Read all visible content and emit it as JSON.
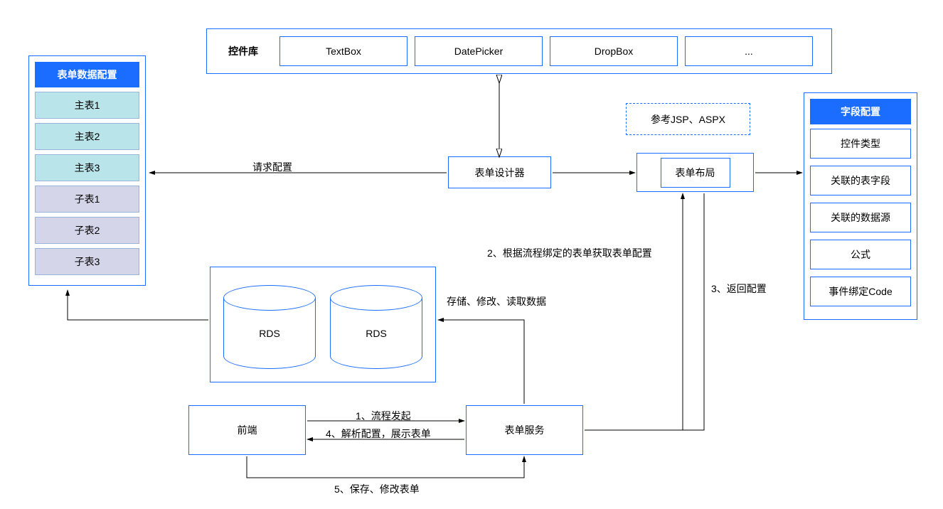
{
  "toolbar": {
    "label": "控件库",
    "items": [
      "TextBox",
      "DatePicker",
      "DropBox",
      "..."
    ]
  },
  "dataPanel": {
    "title": "表单数据配置",
    "mains": [
      "主表1",
      "主表2",
      "主表3"
    ],
    "subs": [
      "子表1",
      "子表2",
      "子表3"
    ]
  },
  "fieldPanel": {
    "title": "字段配置",
    "items": [
      "控件类型",
      "关联的表字段",
      "关联的数据源",
      "公式",
      "事件绑定Code"
    ]
  },
  "boxes": {
    "designer": "表单设计器",
    "layout": "表单布局",
    "ref": "参考JSP、ASPX",
    "frontend": "前端",
    "service": "表单服务",
    "rds": "RDS"
  },
  "labels": {
    "reqConfig": "请求配置",
    "dbOps": "存储、修改、读取数据",
    "step1": "1、流程发起",
    "step2": "2、根据流程绑定的表单获取表单配置",
    "step3": "3、返回配置",
    "step4": "4、解析配置，展示表单",
    "step5": "5、保存、修改表单"
  }
}
